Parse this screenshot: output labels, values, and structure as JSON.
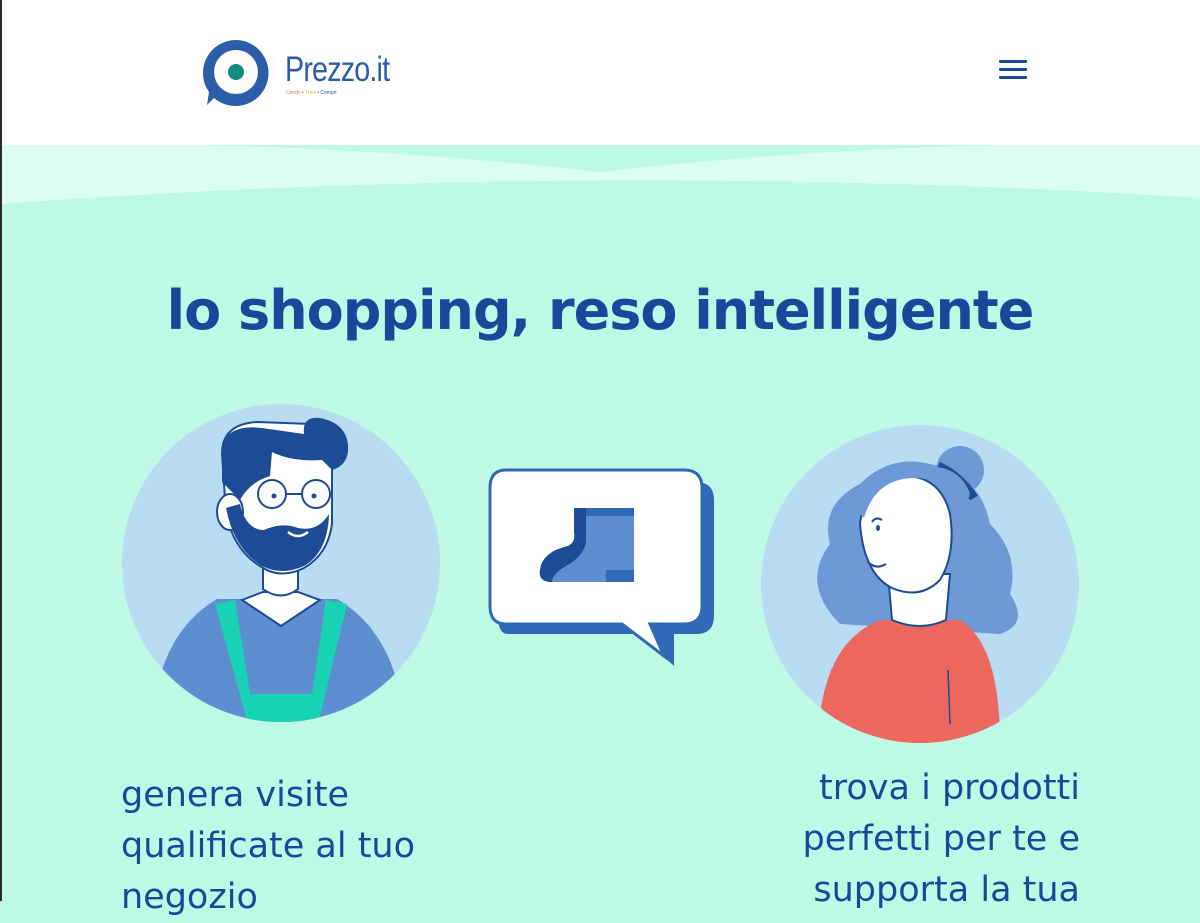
{
  "header": {
    "brand_name": "Prezzo.it",
    "tagline": [
      "Cerchi",
      "Trovi",
      "Compri"
    ],
    "tagline_separator": "•",
    "tagline_colors": [
      "#ef6b5a",
      "#f5a623",
      "#2a5ea8"
    ],
    "menu_icon": "hamburger-menu-icon"
  },
  "hero": {
    "headline": "lo shopping, reso intelligente"
  },
  "features": {
    "left_text": "genera visite qualificate al tuo negozio",
    "right_text": "trova i prodotti perfetti per te e supporta la tua"
  },
  "colors": {
    "background": "#bdf9e5",
    "heading": "#19489a",
    "logo_teal": "#138a7e",
    "apron": "#18d3b3",
    "shirt_red": "#ec675d"
  }
}
